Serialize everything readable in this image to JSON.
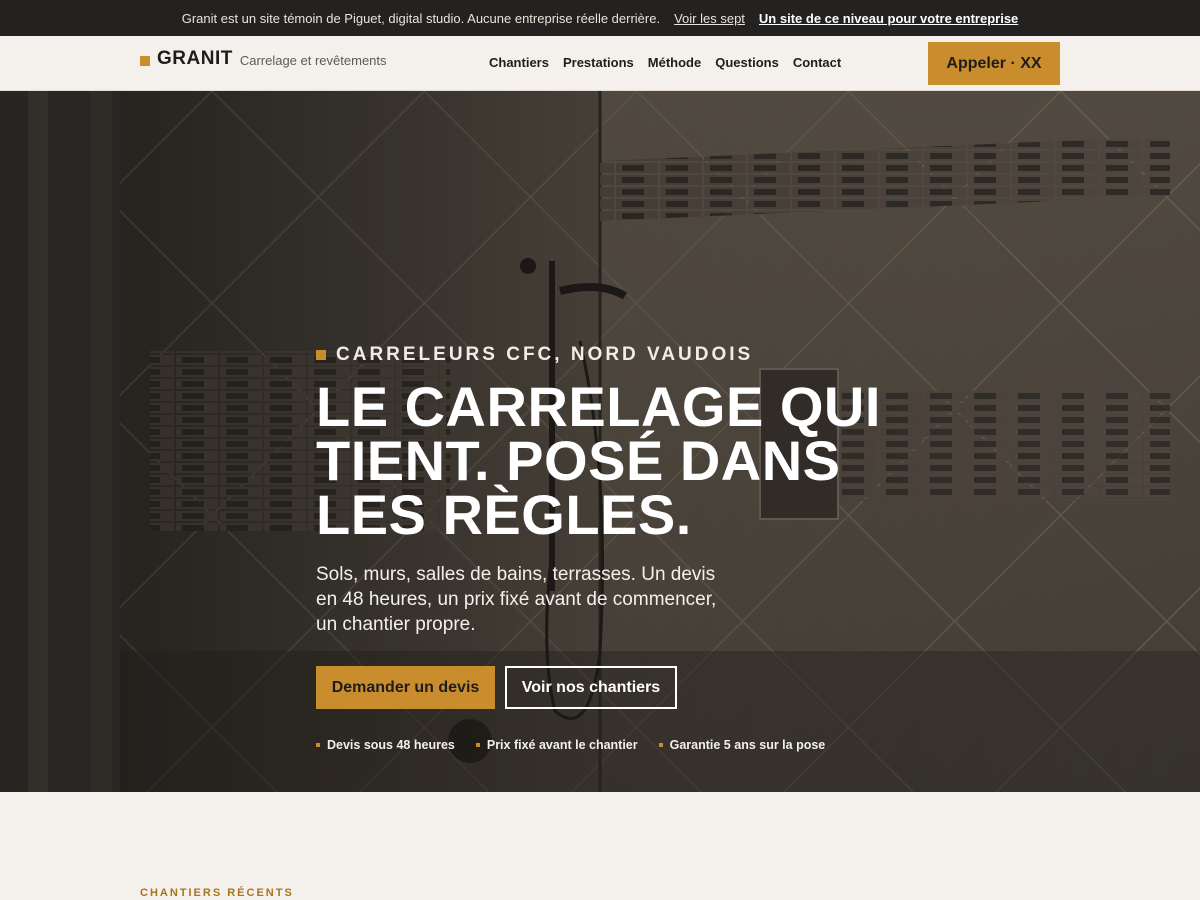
{
  "notice_bar": {
    "message": "Granit est un site témoin de Piguet, digital studio. Aucune entreprise réelle derrière.",
    "link_secondary": "Voir les sept",
    "link_primary": "Un site de ce niveau pour votre entreprise"
  },
  "header": {
    "brand_name": "GRANIT",
    "brand_tagline": "Carrelage et revêtements",
    "nav": [
      "Chantiers",
      "Prestations",
      "Méthode",
      "Questions",
      "Contact"
    ],
    "call_button": "Appeler · XX"
  },
  "hero": {
    "eyebrow": "CARRELEURS CFC, NORD VAUDOIS",
    "title": "LE CARRELAGE QUI TIENT. POSÉ DANS LES RÈGLES.",
    "lead": "Sols, murs, salles de bains, terrasses. Un devis en 48 heures, un prix fixé avant de commencer, un chantier propre.",
    "cta_primary": "Demander un devis",
    "cta_secondary": "Voir nos chantiers",
    "bullets": [
      "Devis sous 48 heures",
      "Prix fixé avant le chantier",
      "Garantie 5 ans sur la pose"
    ]
  },
  "sections": {
    "recent_label": "CHANTIERS RÉCENTS"
  },
  "colors": {
    "accent": "#c98d2e",
    "dark_bar": "#232220",
    "background": "#f4f1ec"
  }
}
